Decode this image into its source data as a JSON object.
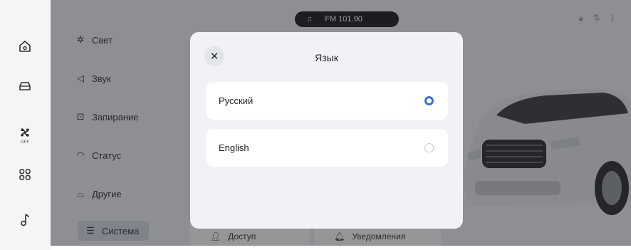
{
  "rail": {
    "items": [
      {
        "icon": "home-icon"
      },
      {
        "icon": "car-icon"
      },
      {
        "icon": "fan-icon",
        "sub": "OFF"
      },
      {
        "icon": "apps-grid-icon"
      },
      {
        "icon": "music-note-icon"
      }
    ]
  },
  "topbar": {
    "music_icon": "music-icon",
    "radio": "FM 101.90"
  },
  "status": {
    "icons": [
      "lock-icon",
      "signal-icon",
      "bluetooth-icon"
    ]
  },
  "menu": {
    "items": [
      {
        "label": "Свет",
        "icon": "light-icon"
      },
      {
        "label": "Звук",
        "icon": "sound-icon"
      },
      {
        "label": "Запирание",
        "icon": "lock-icon"
      },
      {
        "label": "Статус",
        "icon": "gauge-icon"
      },
      {
        "label": "Другие",
        "icon": "car-outline-icon"
      },
      {
        "label": "Система",
        "icon": "sliders-icon"
      }
    ]
  },
  "tiles": {
    "access": "Доступ",
    "notifications": "Уведомления"
  },
  "modal": {
    "title": "Язык",
    "options": [
      {
        "label": "Русский",
        "selected": true
      },
      {
        "label": "English",
        "selected": false
      }
    ]
  },
  "colors": {
    "accent": "#3b6fd8",
    "overlay": "rgba(30,32,36,0.45)"
  }
}
